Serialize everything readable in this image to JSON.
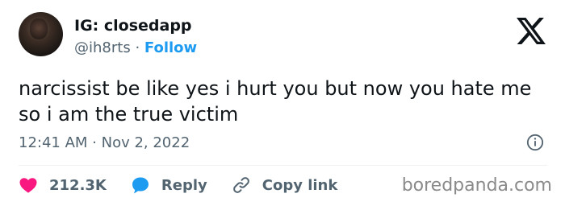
{
  "author": {
    "display_name": "IG: closedapp",
    "handle": "@ih8rts",
    "separator": "·",
    "follow_label": "Follow"
  },
  "tweet": {
    "text": "narcissist be like yes i hurt you but now you hate me so i am the true victim",
    "timestamp": "12:41 AM · Nov 2, 2022"
  },
  "actions": {
    "like_count": "212.3K",
    "reply_label": "Reply",
    "copy_link_label": "Copy link"
  },
  "watermark": "boredpanda.com",
  "icons": [
    "x-logo-icon",
    "info-icon",
    "heart-icon",
    "reply-bubble-icon",
    "link-icon"
  ],
  "colors": {
    "accent": "#1d9bf0",
    "like": "#f91880",
    "muted": "#536471",
    "text": "#0f1419"
  }
}
